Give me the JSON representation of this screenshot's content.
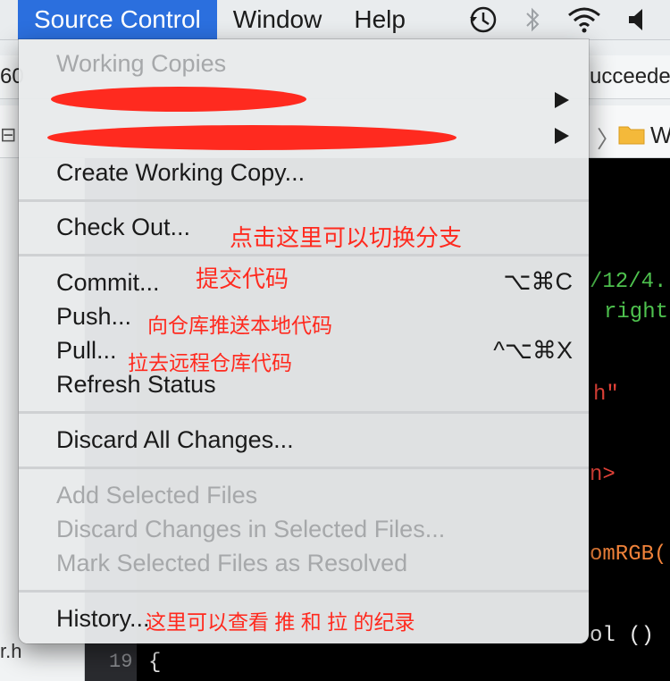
{
  "menubar": {
    "items": [
      "Source Control",
      "Window",
      "Help"
    ],
    "active": "Source Control",
    "tray_icons": [
      "time-machine-icon",
      "bluetooth-icon",
      "wifi-icon",
      "volume-icon"
    ]
  },
  "background": {
    "left_snippet": "60",
    "right_snippet": "ucceede",
    "folder_letter": "W",
    "file_snippet": "r.h",
    "line_number": "19",
    "code_lines": [
      "/12/4.",
      "right",
      "h\"",
      "n>",
      "omRGB(",
      "ol ()",
      "{"
    ]
  },
  "menu": {
    "section_header": "Working Copies",
    "create_working_copy": "Create Working Copy...",
    "check_out": "Check Out...",
    "commit": "Commit...",
    "commit_shortcut": "⌥⌘C",
    "push": "Push...",
    "pull": "Pull...",
    "pull_shortcut": "^⌥⌘X",
    "refresh_status": "Refresh Status",
    "discard_all": "Discard All Changes...",
    "add_selected": "Add Selected Files",
    "discard_selected": "Discard Changes in Selected Files...",
    "mark_resolved": "Mark Selected Files as Resolved",
    "history": "History..."
  },
  "annotations": {
    "check_out": "点击这里可以切换分支",
    "commit": "提交代码",
    "push": "向仓库推送本地代码",
    "pull": "拉去远程仓库代码",
    "history": "这里可以查看 推 和 拉 的纪录"
  },
  "colors": {
    "menubar_active": "#2b6fde",
    "annotation_red": "#ff2a1f",
    "code_green": "#4ec24e",
    "code_orange": "#f0823a",
    "code_red": "#e8443a"
  }
}
